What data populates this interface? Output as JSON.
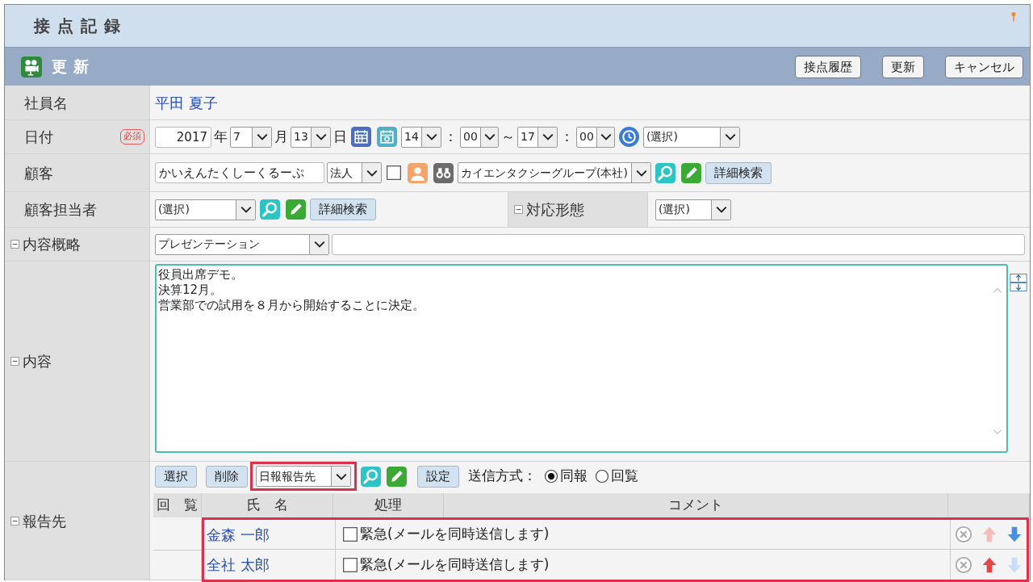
{
  "window": {
    "title": "接点記録"
  },
  "header": {
    "title": "更新",
    "buttons": [
      "接点履歴",
      "更新",
      "キャンセル"
    ]
  },
  "rows": [
    {
      "label": "社員名",
      "items": [
        {
          "kind": "link",
          "text": "平田 夏子"
        }
      ]
    },
    {
      "label": "日付",
      "badge": "必須",
      "items": [
        {
          "kind": "input",
          "value": "2017"
        },
        {
          "kind": "text",
          "text": "年"
        },
        {
          "kind": "select",
          "text": "7"
        },
        {
          "kind": "text",
          "text": "月"
        },
        {
          "kind": "select",
          "text": "13"
        },
        {
          "kind": "text",
          "text": "日"
        },
        {
          "kind": "calendar"
        },
        {
          "kind": "datepicker"
        },
        {
          "kind": "select",
          "text": "14"
        },
        {
          "kind": "text",
          "text": "："
        },
        {
          "kind": "select",
          "text": "00"
        },
        {
          "kind": "text",
          "text": "～"
        },
        {
          "kind": "select",
          "text": "17"
        },
        {
          "kind": "text",
          "text": "："
        },
        {
          "kind": "select",
          "text": "00"
        },
        {
          "kind": "clock"
        },
        {
          "kind": "select",
          "text": "(選択)"
        }
      ]
    },
    {
      "label": "顧客",
      "items": [
        {
          "kind": "input",
          "value": "かいえんたくしーくるーぷ"
        },
        {
          "kind": "select",
          "text": "法人"
        },
        {
          "kind": "checkbox",
          "checked": false
        },
        {
          "kind": "person"
        },
        {
          "kind": "binoculars"
        },
        {
          "kind": "select",
          "text": "カイエンタクシーグループ(本社)"
        },
        {
          "kind": "search"
        },
        {
          "kind": "edit"
        },
        {
          "kind": "button",
          "text": "詳細検索"
        }
      ]
    },
    {
      "label": "顧客担当者",
      "items": [
        {
          "kind": "select",
          "text": "(選択)"
        },
        {
          "kind": "search"
        },
        {
          "kind": "edit"
        },
        {
          "kind": "button",
          "text": "詳細検索"
        },
        {
          "kind": "sublabel",
          "text": "対応形態",
          "expanded": true
        },
        {
          "kind": "select",
          "text": "(選択)"
        }
      ]
    },
    {
      "label": "内容概略",
      "expanded": true,
      "items": [
        {
          "kind": "select",
          "text": "プレゼンテーション"
        },
        {
          "kind": "input"
        }
      ]
    },
    {
      "label": "内容",
      "expanded": true,
      "items": [
        {
          "kind": "textarea",
          "lines": [
            "役員出席デモ。",
            "決算12月。",
            "営業部での試用を８月から開始することに決定。"
          ]
        }
      ]
    },
    {
      "label": "報告先",
      "expanded": true,
      "items": [
        {
          "kind": "button",
          "text": "選択"
        },
        {
          "kind": "button",
          "text": "削除"
        },
        {
          "kind": "select",
          "text": "日報報告先",
          "highlighted": true
        },
        {
          "kind": "search"
        },
        {
          "kind": "edit"
        },
        {
          "kind": "button",
          "text": "設定"
        },
        {
          "kind": "text",
          "text": "送信方式："
        },
        {
          "kind": "radio",
          "text": "同報",
          "selected": true
        },
        {
          "kind": "radio",
          "text": "回覧",
          "selected": false
        }
      ],
      "table": {
        "columns": [
          "回　覧",
          "氏　名",
          "処理",
          "コメント"
        ],
        "rows_highlighted": true,
        "rows": [
          {
            "name": "金森 一郎",
            "urgent_label": "緊急(メールを同時送信します)",
            "urgent": false,
            "up_enabled": false,
            "down_enabled": true
          },
          {
            "name": "全社 太郎",
            "urgent_label": "緊急(メールを同時送信します)",
            "urgent": false,
            "up_enabled": true,
            "down_enabled": false
          }
        ]
      }
    }
  ]
}
